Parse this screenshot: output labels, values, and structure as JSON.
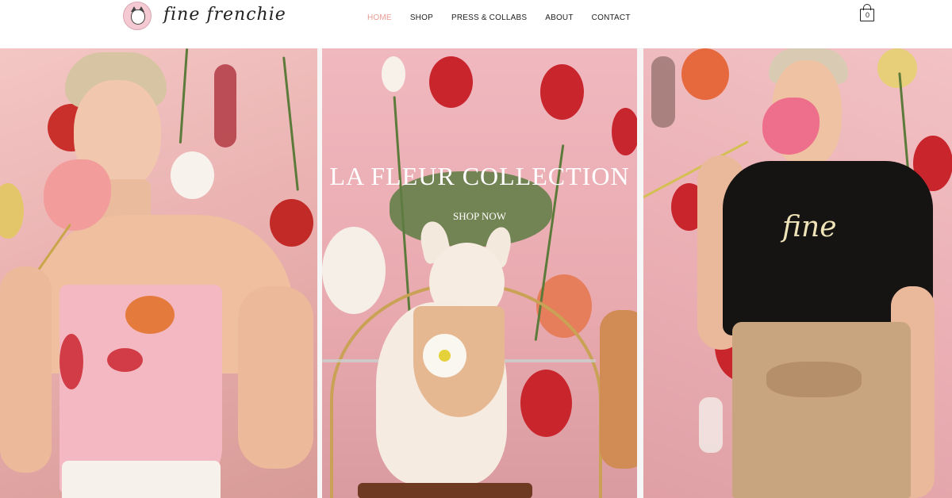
{
  "brand": {
    "logo_text": "fine frenchie",
    "logo_icon": "frenchie-logo-icon"
  },
  "nav": {
    "items": [
      {
        "label": "HOME",
        "active": true
      },
      {
        "label": "SHOP",
        "active": false
      },
      {
        "label": "PRESS & COLLABS",
        "active": false
      },
      {
        "label": "ABOUT",
        "active": false
      },
      {
        "label": "CONTACT",
        "active": false
      }
    ],
    "active_color": "#e89a91"
  },
  "cart": {
    "count": "0",
    "icon": "shopping-bag-icon"
  },
  "hero": {
    "title": "LA FLEUR COLLECTION",
    "cta": "SHOP NOW"
  },
  "panels": {
    "left_image": "woman-in-floral-scarf-top-photo",
    "center_image": "french-bulldog-with-scarf-photo",
    "right_image": "woman-in-black-fine-tee-photo",
    "tee_text": "fine"
  }
}
